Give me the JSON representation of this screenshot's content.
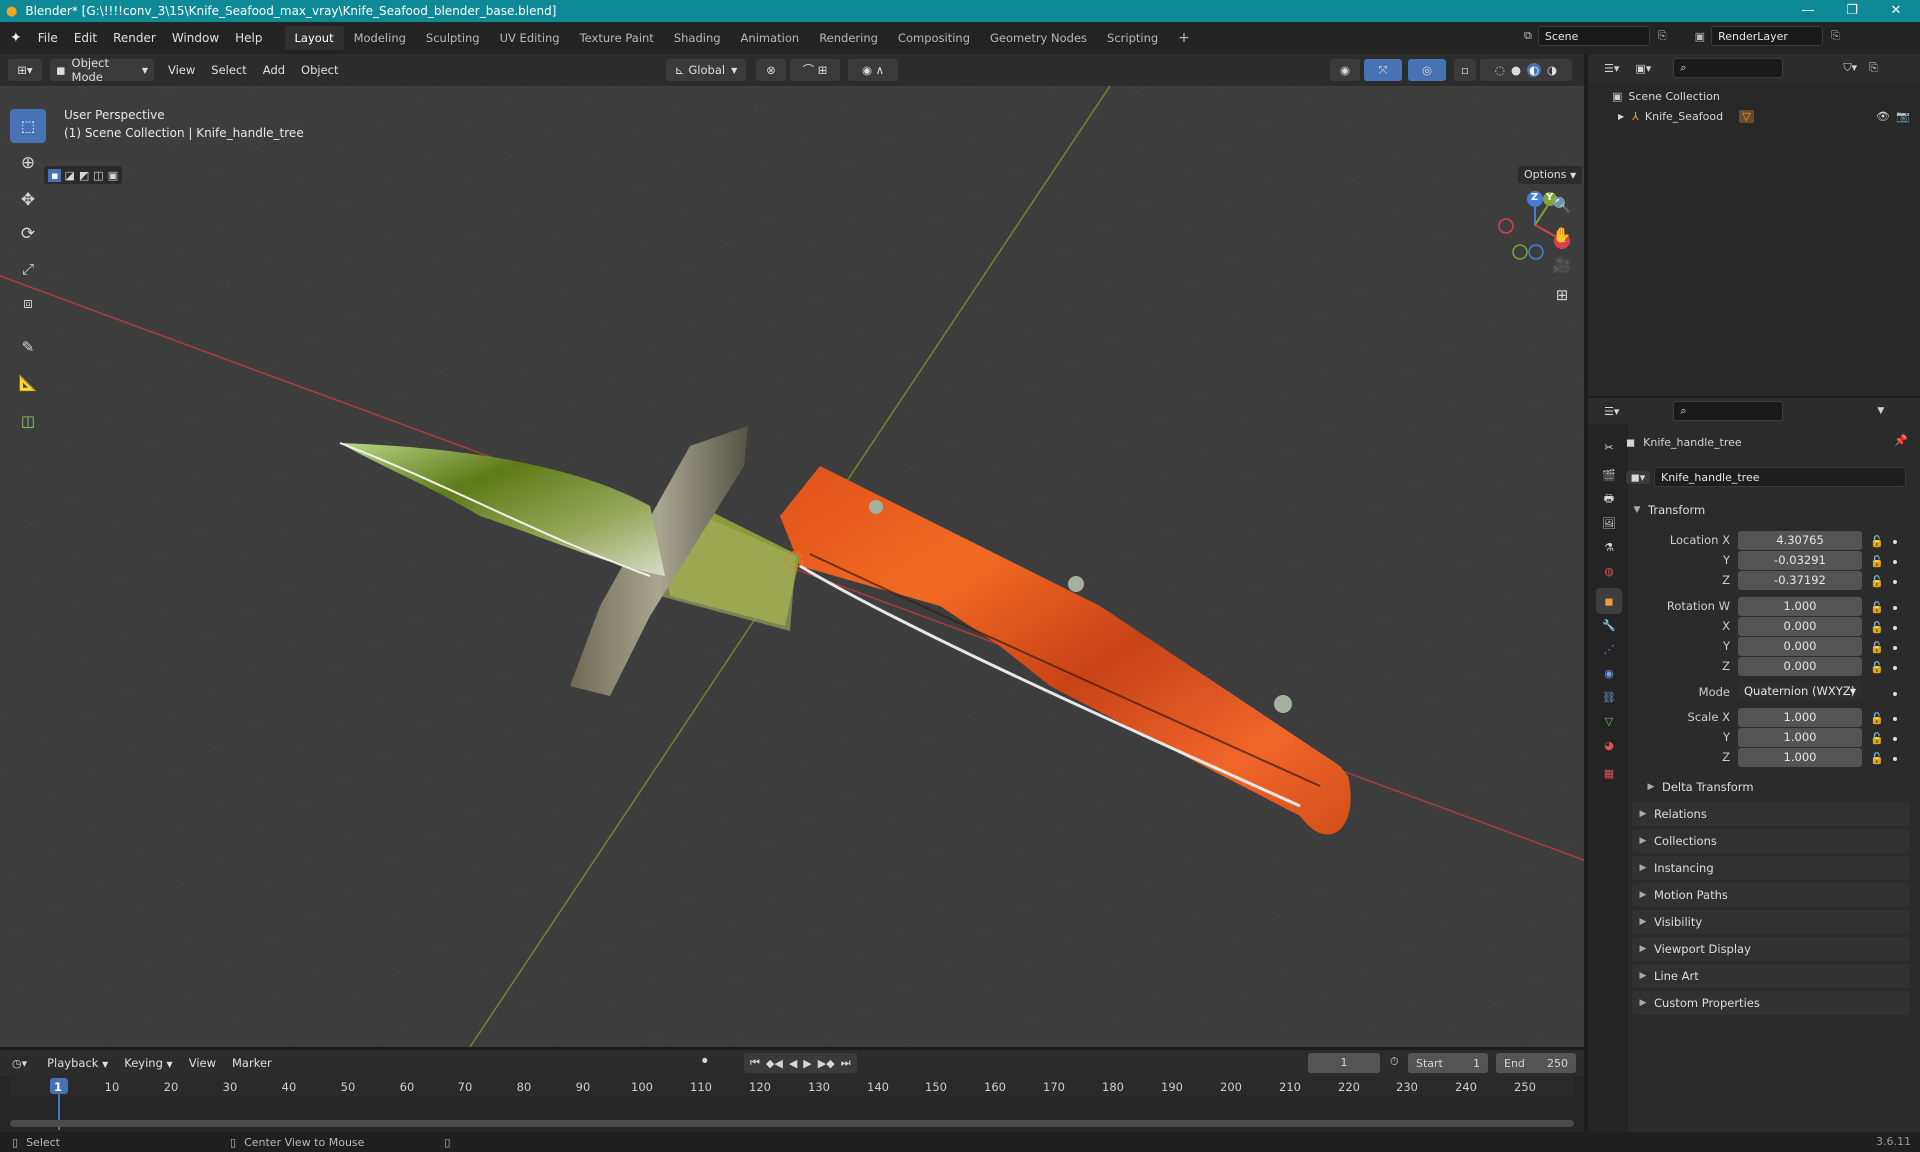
{
  "window": {
    "title": "Blender* [G:\\!!!!conv_3\\15\\Knife_Seafood_max_vray\\Knife_Seafood_blender_base.blend]",
    "controls": [
      "—",
      "❐",
      "✕"
    ]
  },
  "menu": {
    "items": [
      "File",
      "Edit",
      "Render",
      "Window",
      "Help"
    ],
    "workspaces": [
      "Layout",
      "Modeling",
      "Sculpting",
      "UV Editing",
      "Texture Paint",
      "Shading",
      "Animation",
      "Rendering",
      "Compositing",
      "Geometry Nodes",
      "Scripting"
    ],
    "active_workspace": "Layout",
    "add_tab": "+",
    "scene": "Scene",
    "render_layer": "RenderLayer"
  },
  "viewport_header": {
    "mode": "Object Mode",
    "menus": [
      "View",
      "Select",
      "Add",
      "Object"
    ],
    "orientation": "Global",
    "options": "Options"
  },
  "viewport": {
    "perspective": "User Perspective",
    "collection_path": "(1) Scene Collection | Knife_handle_tree",
    "gizmo_axes": [
      "Z",
      "Y",
      "X"
    ],
    "accent_active_tool": "#4772b3"
  },
  "outliner": {
    "root": "Scene Collection",
    "items": [
      {
        "label": "Knife_Seafood"
      }
    ]
  },
  "properties": {
    "object_name": "Knife_handle_tree",
    "data_name": "Knife_handle_tree",
    "transform_title": "Transform",
    "location_label": "Location X",
    "location": [
      "4.30765",
      "-0.03291",
      "-0.37192"
    ],
    "rotation_label": "Rotation W",
    "rotation": [
      "1.000",
      "0.000",
      "0.000",
      "0.000"
    ],
    "axis_labels": [
      "X",
      "Y",
      "Z"
    ],
    "mode_label": "Mode",
    "mode_value": "Quaternion (WXYZ)",
    "scale_label": "Scale X",
    "scale": [
      "1.000",
      "1.000",
      "1.000"
    ],
    "delta": "Delta Transform",
    "panels": [
      "Relations",
      "Collections",
      "Instancing",
      "Motion Paths",
      "Visibility",
      "Viewport Display",
      "Line Art",
      "Custom Properties"
    ]
  },
  "timeline": {
    "menus": [
      "Playback",
      "Keying",
      "View",
      "Marker"
    ],
    "current_frame": "1",
    "start_label": "Start",
    "start": "1",
    "end_label": "End",
    "end": "250",
    "ticks": [
      "1",
      "10",
      "20",
      "30",
      "40",
      "50",
      "60",
      "70",
      "80",
      "90",
      "100",
      "110",
      "120",
      "130",
      "140",
      "150",
      "160",
      "170",
      "180",
      "190",
      "200",
      "210",
      "220",
      "230",
      "240",
      "250"
    ]
  },
  "status": {
    "select": "Select",
    "center": "Center View to Mouse",
    "version": "3.6.11"
  }
}
